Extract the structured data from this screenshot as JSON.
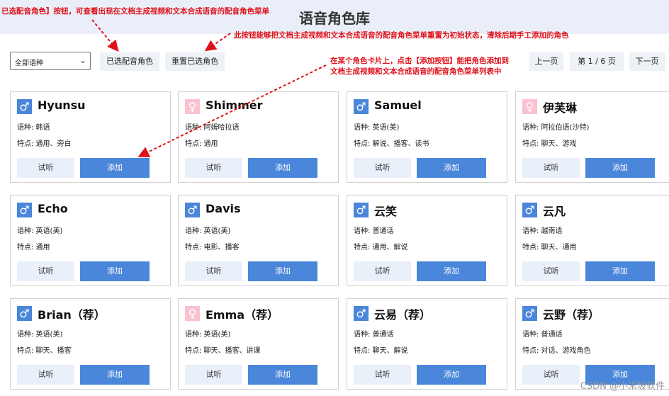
{
  "header": {
    "title": "语音角色库"
  },
  "annotations": {
    "a1": "已选配音角色】按钮，可查看出现在文档主成视频和文本合成语音的配音角色菜单",
    "a2": "此按钮能够把文档主成视频和文本合成语音的配音角色菜单重置为初始状态，清除后期手工添加的角色",
    "a3_line1": "在某个角色卡片上，点击【添加按钮】能把角色添加到",
    "a3_line2": "文档主成视频和文本合成语音的配音角色菜单列表中"
  },
  "toolbar": {
    "language_select": "全部语种",
    "selected_roles": "已选配音角色",
    "reset_roles": "重置已选角色",
    "prev_page": "上一页",
    "page_indicator": "第 1 / 6 页",
    "next_page": "下一页"
  },
  "cards": [
    {
      "name": "Hyunsu",
      "gender": "male",
      "lang": "语种: 韩语",
      "feat": "特点: 通用、旁白"
    },
    {
      "name": "Shimmer",
      "gender": "female",
      "lang": "语种: 阿姆哈拉语",
      "feat": "特点: 通用"
    },
    {
      "name": "Samuel",
      "gender": "male",
      "lang": "语种: 英语(美)",
      "feat": "特点: 解说、播客、读书"
    },
    {
      "name": "伊芙琳",
      "gender": "female",
      "lang": "语种: 阿拉伯语(沙特)",
      "feat": "特点: 聊天、游戏"
    },
    {
      "name": "Echo",
      "gender": "male",
      "lang": "语种: 英语(美)",
      "feat": "特点: 通用"
    },
    {
      "name": "Davis",
      "gender": "male",
      "lang": "语种: 英语(美)",
      "feat": "特点: 电影、播客"
    },
    {
      "name": "云笑",
      "gender": "male",
      "lang": "语种: 普通话",
      "feat": "特点: 通用、解说"
    },
    {
      "name": "云凡",
      "gender": "male",
      "lang": "语种: 越南语",
      "feat": "特点: 聊天、通用"
    },
    {
      "name": "Brian（荐）",
      "gender": "male",
      "lang": "语种: 英语(美)",
      "feat": "特点: 聊天、播客"
    },
    {
      "name": "Emma（荐）",
      "gender": "female",
      "lang": "语种: 英语(美)",
      "feat": "特点: 聊天、播客、讲课"
    },
    {
      "name": "云易（荐）",
      "gender": "male",
      "lang": "语种: 普通话",
      "feat": "特点: 聊天、解说"
    },
    {
      "name": "云野（荐）",
      "gender": "male",
      "lang": "语种: 普通话",
      "feat": "特点: 对话、游戏角色"
    }
  ],
  "card_buttons": {
    "try": "试听",
    "add": "添加"
  },
  "icons": {
    "male": "♂",
    "female": "♀"
  },
  "colors": {
    "accent": "#4a86d9",
    "annotation": "#e0101a",
    "female_icon": "#f9c2ce"
  },
  "watermark": "CSDN @小米坡软件"
}
